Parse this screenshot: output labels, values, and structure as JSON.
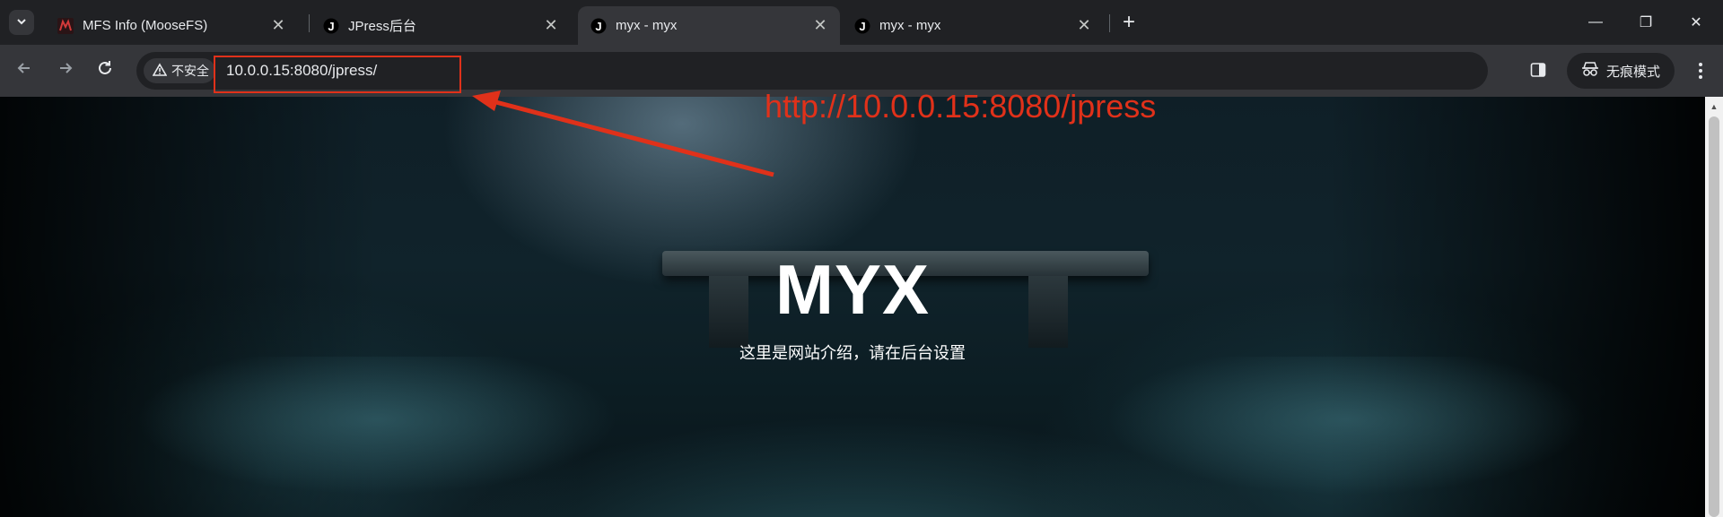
{
  "tabs": [
    {
      "title": "MFS Info (MooseFS)",
      "icon": "moosefs-icon",
      "active": false
    },
    {
      "title": "JPress后台",
      "icon": "jpress-icon",
      "active": false
    },
    {
      "title": "myx - myx",
      "icon": "jpress-icon",
      "active": true
    },
    {
      "title": "myx - myx",
      "icon": "jpress-icon",
      "active": false
    }
  ],
  "tab_close_glyph": "✕",
  "new_tab_glyph": "+",
  "window_controls": {
    "minimize": "—",
    "restore": "❐",
    "close": "✕"
  },
  "toolbar": {
    "security_label": "不安全",
    "url": "10.0.0.15:8080/jpress/",
    "incognito_label": "无痕模式"
  },
  "page": {
    "site_title": "MYX",
    "site_description": "这里是网站介绍，请在后台设置"
  },
  "annotation": {
    "text": "http://10.0.0.15:8080/jpress",
    "color": "#e0311a"
  }
}
